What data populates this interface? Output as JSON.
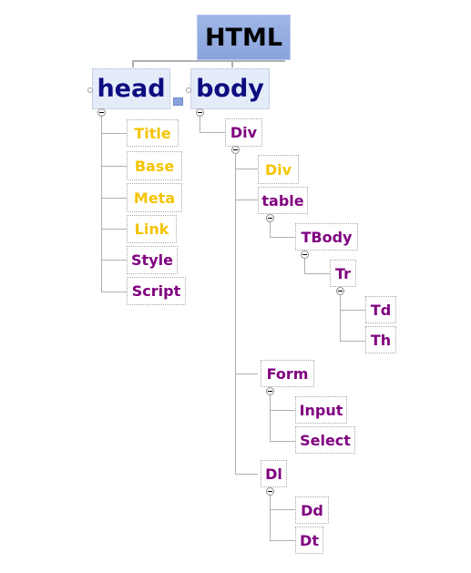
{
  "colors": {
    "yellow": "#f5c400",
    "purple": "#800080",
    "navy": "#0d0d80"
  },
  "root": {
    "label": "HTML"
  },
  "head": {
    "label": "head",
    "children": [
      {
        "label": "Title",
        "color": "yellow"
      },
      {
        "label": "Base",
        "color": "yellow"
      },
      {
        "label": "Meta",
        "color": "yellow"
      },
      {
        "label": "Link",
        "color": "yellow"
      },
      {
        "label": "Style",
        "color": "purple"
      },
      {
        "label": "Script",
        "color": "purple"
      }
    ]
  },
  "body": {
    "label": "body",
    "div": {
      "label": "Div",
      "children": {
        "div": {
          "label": "Div",
          "color": "yellow"
        },
        "table": {
          "label": "table",
          "tbody": {
            "label": "TBody",
            "tr": {
              "label": "Tr",
              "children": [
                {
                  "label": "Td"
                },
                {
                  "label": "Th"
                }
              ]
            }
          }
        },
        "form": {
          "label": "Form",
          "children": [
            {
              "label": "Input"
            },
            {
              "label": "Select"
            }
          ]
        },
        "dl": {
          "label": "Dl",
          "children": [
            {
              "label": "Dd"
            },
            {
              "label": "Dt"
            }
          ]
        }
      }
    }
  }
}
